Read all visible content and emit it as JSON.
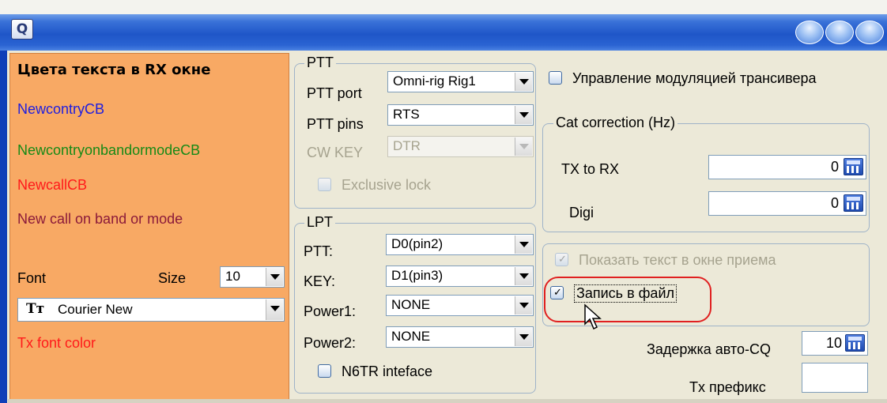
{
  "window": {
    "app_icon_label": "Q"
  },
  "rx_colors": {
    "title": "Цвета текста в RX окне",
    "newcontry": "NewcontryCB",
    "newcontry_color": "#1e1ee0",
    "newcontry_onband": "NewcontryonbandormodeCB",
    "newcontry_onband_color": "#168a16",
    "newcall": "NewcallCB",
    "newcall_color": "#ff1a1a",
    "new_call_band_mode": "New call on band or mode",
    "new_call_band_mode_color": "#8b1a3a",
    "font_label": "Font",
    "size_label": "Size",
    "size_value": "10",
    "font_icon": "truetype-font-icon",
    "font_value": "Courier New",
    "tx_font_color": "Tx font color",
    "tx_font_color_color": "#ff1a1a"
  },
  "ptt": {
    "legend": "PTT",
    "port_label": "PTT port",
    "port_value": "Omni-rig Rig1",
    "pins_label": "PTT pins",
    "pins_value": "RTS",
    "cwkey_label": "CW KEY",
    "cwkey_value": "DTR",
    "exclusive_lock": "Exclusive lock"
  },
  "lpt": {
    "legend": "LPT",
    "ptt_label": "PTT:",
    "ptt_value": "D0(pin2)",
    "key_label": "KEY:",
    "key_value": "D1(pin3)",
    "power1_label": "Power1:",
    "power1_value": "NONE",
    "power2_label": "Power2:",
    "power2_value": "NONE",
    "n6tr": "N6TR inteface"
  },
  "right": {
    "modulation": "Управление модуляцией трансивера",
    "cat_legend": "Cat correction (Hz)",
    "tx_to_rx_label": "TX to RX",
    "tx_to_rx_value": "0",
    "digi_label": "Digi",
    "digi_value": "0",
    "show_text": "Показать текст в окне приема",
    "write_file": "Запись в файл",
    "autocq_label": "Задержка авто-CQ",
    "autocq_value": "10",
    "tx_prefix_label": "Tx префикс",
    "tx_prefix_value": ""
  }
}
